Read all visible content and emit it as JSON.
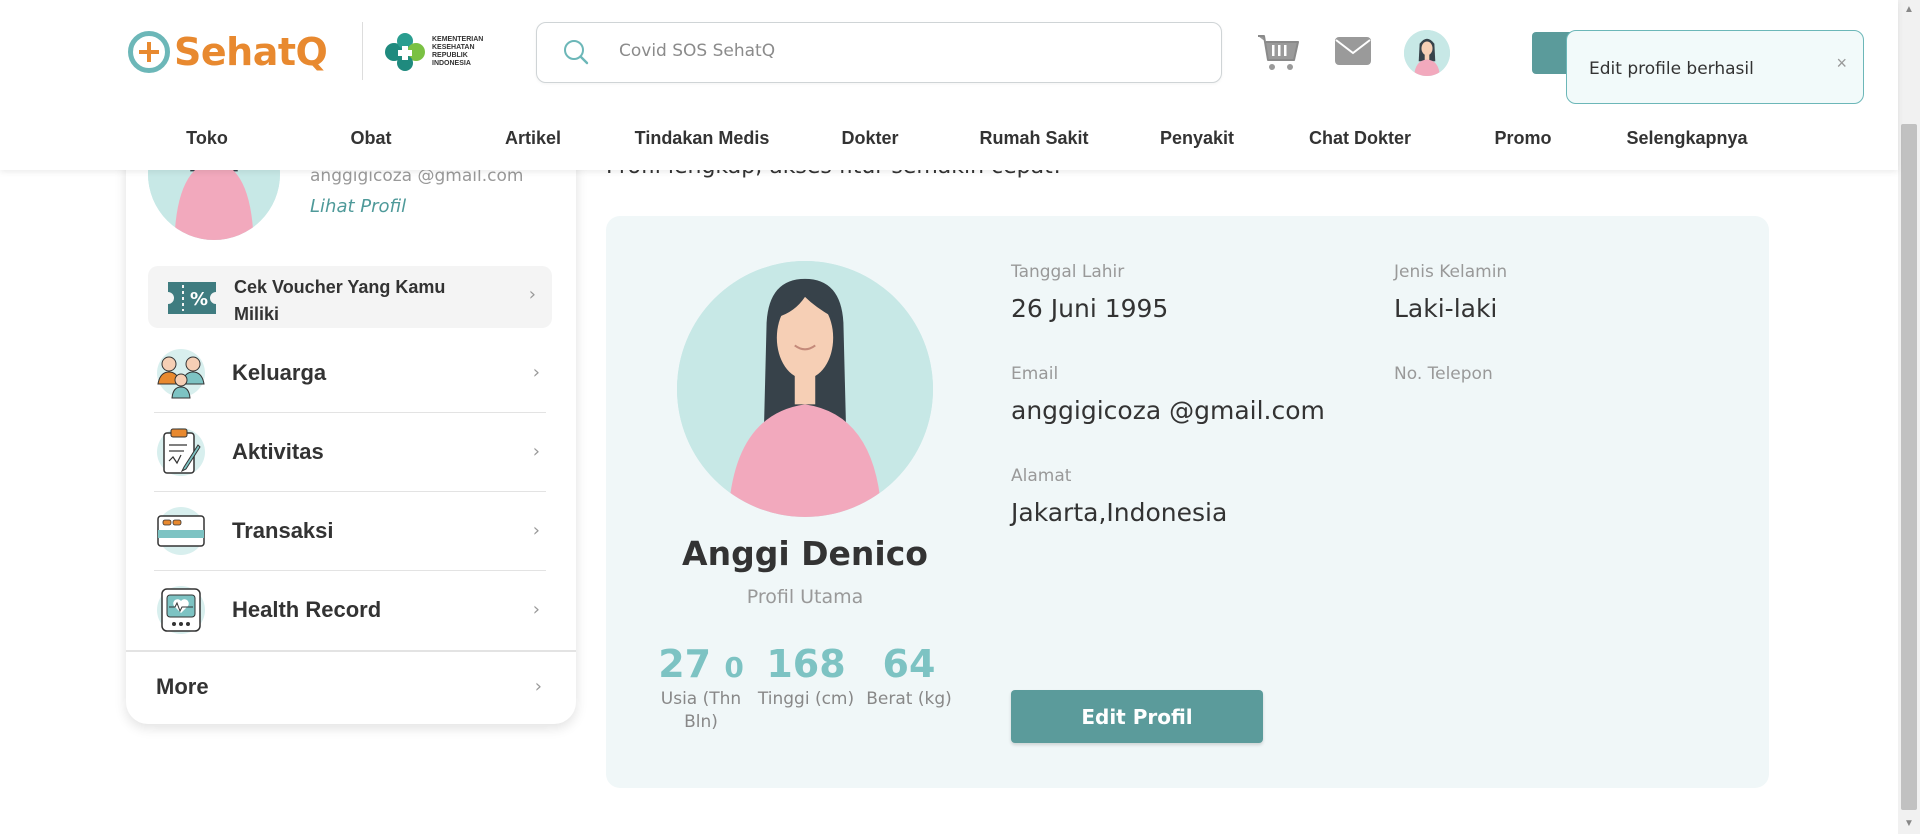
{
  "brand": {
    "name": "SehatQ",
    "partner": "KEMENTERIAN KESEHATAN REPUBLIK INDONESIA"
  },
  "search": {
    "placeholder": "Covid SOS SehatQ"
  },
  "header": {
    "icons": [
      "cart-icon",
      "mail-icon",
      "avatar"
    ]
  },
  "toast": {
    "message": "Edit profile berhasil",
    "close": "×"
  },
  "nav": {
    "items": [
      {
        "label": "Toko"
      },
      {
        "label": "Obat"
      },
      {
        "label": "Artikel"
      },
      {
        "label": "Tindakan Medis"
      },
      {
        "label": "Dokter"
      },
      {
        "label": "Rumah Sakit"
      },
      {
        "label": "Penyakit"
      },
      {
        "label": "Chat Dokter"
      },
      {
        "label": "Promo"
      },
      {
        "label": "Selengkapnya"
      }
    ]
  },
  "sidebar": {
    "email": "anggigicoza @gmail.com",
    "profile_link": "Lihat Profil",
    "voucher_label": "Cek Voucher Yang Kamu Miliki",
    "menu": [
      {
        "label": "Keluarga",
        "icon": "family-icon"
      },
      {
        "label": "Aktivitas",
        "icon": "clipboard-icon"
      },
      {
        "label": "Transaksi",
        "icon": "card-icon"
      },
      {
        "label": "Health Record",
        "icon": "health-monitor-icon"
      }
    ],
    "more_label": "More"
  },
  "main": {
    "tagline": "Profil lengkap, akses fitur semakin cepat!",
    "profile": {
      "name": "Anggi Denico",
      "subtitle": "Profil Utama",
      "stats": [
        {
          "value": "27",
          "suffix": "0",
          "label": "Usia (Thn Bln)"
        },
        {
          "value": "168",
          "suffix": "",
          "label": "Tinggi (cm)"
        },
        {
          "value": "64",
          "suffix": "",
          "label": "Berat (kg)"
        }
      ],
      "fields": {
        "birth_label": "Tanggal Lahir",
        "birth_value": "26 Juni 1995",
        "gender_label": "Jenis Kelamin",
        "gender_value": "Laki-laki",
        "email_label": "Email",
        "email_value": "anggigicoza @gmail.com",
        "phone_label": "No. Telepon",
        "phone_value": "",
        "address_label": "Alamat",
        "address_value": "Jakarta,Indonesia"
      },
      "edit_button": "Edit Profil"
    }
  },
  "colors": {
    "primary": "#5b9b9b",
    "accent": "#e8892f",
    "teal_light": "#7dc3c3",
    "card_bg": "#f0f7f8"
  }
}
